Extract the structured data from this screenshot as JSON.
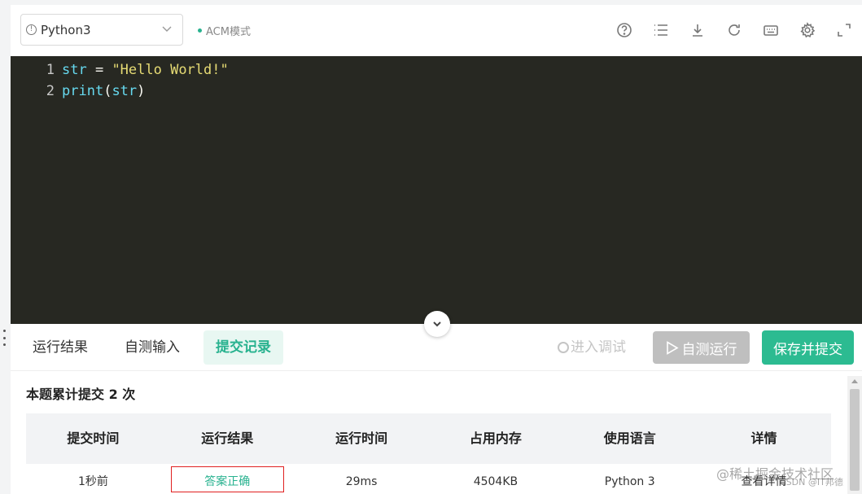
{
  "toolbar": {
    "language": "Python3",
    "mode": "ACM模式",
    "icons": [
      "help-icon",
      "list-icon",
      "download-icon",
      "refresh-icon",
      "keyboard-icon",
      "settings-icon",
      "fullscreen-icon"
    ]
  },
  "editor": {
    "lines": [
      {
        "no": "1",
        "tokens": [
          "str",
          " = ",
          "\"Hello World!\""
        ]
      },
      {
        "no": "2",
        "tokens": [
          "print",
          "(",
          "str",
          ")"
        ]
      }
    ]
  },
  "tabs": [
    "运行结果",
    "自测输入",
    "提交记录"
  ],
  "active_tab": "提交记录",
  "actions": {
    "debug": "进入调试",
    "run": "自测运行",
    "submit": "保存并提交"
  },
  "summary": "本题累计提交 2 次",
  "table": {
    "headers": [
      "提交时间",
      "运行结果",
      "运行时间",
      "占用内存",
      "使用语言",
      "详情"
    ],
    "rows": [
      [
        "1秒前",
        "答案正确",
        "29ms",
        "4504KB",
        "Python 3",
        "查看详情"
      ]
    ]
  },
  "watermark": "@稀土掘金技术社区",
  "watermark_small": "CSDN @IT邦德",
  "colors": {
    "accent": "#28b28f",
    "editor_bg": "#272822",
    "highlight_border": "#e02020"
  }
}
